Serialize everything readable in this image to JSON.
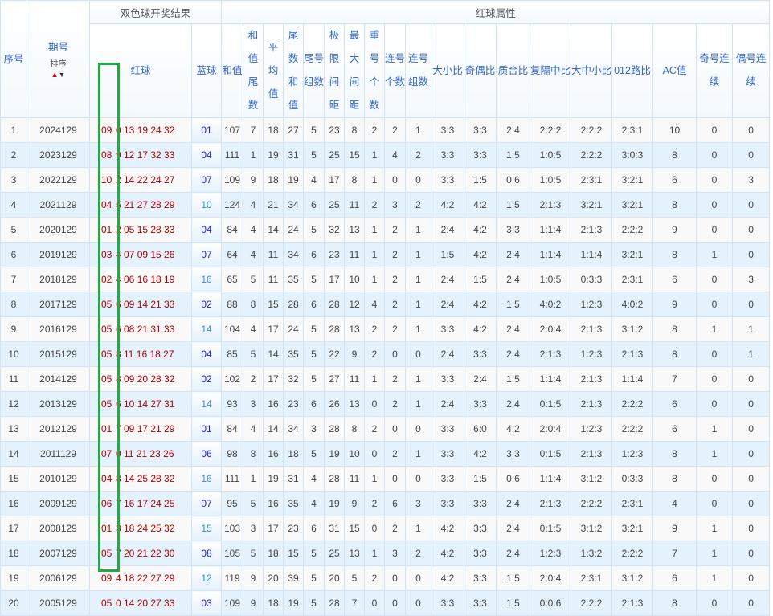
{
  "header": {
    "seq": "序号",
    "period": "期号",
    "sort_label": "排序",
    "sort_up": "▲",
    "sort_down": "▼",
    "result_group": "双色球开奖结果",
    "attr_group": "红球属性",
    "red": "红球",
    "blue": "蓝球",
    "columns": [
      "和值",
      "和值尾数",
      "平均值",
      "尾数和值",
      "尾号组数",
      "极限间距",
      "最大间距",
      "重号个数",
      "连号个数",
      "连号组数",
      "大小比",
      "奇偶比",
      "质合比",
      "复隔中比",
      "大中小比",
      "012路比",
      "AC值",
      "奇号连续",
      "偶号连续"
    ]
  },
  "colors": {
    "red_ball": "#b40000",
    "blue_ball_low": "#1a1ae6",
    "blue_ball_high": "#3d85f0",
    "highlight": "#22aa44",
    "row_alt": "#e3f2fd"
  },
  "rows": [
    [
      "1",
      "2024129",
      "09",
      "0 13 19 24 32",
      "01",
      "107",
      "7",
      "18",
      "27",
      "5",
      "23",
      "8",
      "2",
      "2",
      "1",
      "3:3",
      "3:3",
      "2:4",
      "2:2:2",
      "2:2:2",
      "2:3:1",
      "10",
      "0",
      "0"
    ],
    [
      "2",
      "2023129",
      "08",
      "9 12 17 32 33",
      "04",
      "111",
      "1",
      "19",
      "31",
      "5",
      "25",
      "15",
      "1",
      "4",
      "2",
      "3:3",
      "3:3",
      "1:5",
      "1:0:5",
      "2:2:2",
      "3:0:3",
      "8",
      "0",
      "0"
    ],
    [
      "3",
      "2022129",
      "10",
      "2 14 22 24 27",
      "07",
      "109",
      "9",
      "18",
      "19",
      "4",
      "17",
      "8",
      "1",
      "0",
      "0",
      "3:3",
      "1:5",
      "0:6",
      "1:0:5",
      "2:3:1",
      "3:2:1",
      "6",
      "0",
      "3"
    ],
    [
      "4",
      "2021129",
      "04",
      "5 21 27 28 29",
      "10",
      "124",
      "4",
      "21",
      "34",
      "6",
      "25",
      "11",
      "2",
      "3",
      "2",
      "4:2",
      "4:2",
      "1:5",
      "2:1:3",
      "3:2:1",
      "3:2:1",
      "8",
      "0",
      "0"
    ],
    [
      "5",
      "2020129",
      "01",
      "2 05 15 28 33",
      "04",
      "84",
      "4",
      "14",
      "24",
      "5",
      "32",
      "13",
      "1",
      "2",
      "1",
      "2:4",
      "4:2",
      "3:3",
      "1:1:4",
      "2:1:3",
      "2:2:2",
      "9",
      "0",
      "0"
    ],
    [
      "6",
      "2019129",
      "03",
      "4 07 09 15 26",
      "07",
      "64",
      "4",
      "11",
      "34",
      "6",
      "23",
      "11",
      "1",
      "2",
      "1",
      "1:5",
      "4:2",
      "2:4",
      "1:1:4",
      "1:1:4",
      "3:2:1",
      "8",
      "1",
      "0"
    ],
    [
      "7",
      "2018129",
      "02",
      "4 06 16 18 19",
      "16",
      "65",
      "5",
      "11",
      "35",
      "5",
      "17",
      "10",
      "1",
      "2",
      "1",
      "2:4",
      "1:5",
      "2:4",
      "1:0:5",
      "0:3:3",
      "2:3:1",
      "6",
      "0",
      "3"
    ],
    [
      "8",
      "2017129",
      "05",
      "6 09 14 21 33",
      "02",
      "88",
      "8",
      "15",
      "28",
      "6",
      "28",
      "12",
      "4",
      "2",
      "1",
      "2:4",
      "4:2",
      "1:5",
      "4:0:2",
      "1:2:3",
      "4:0:2",
      "9",
      "0",
      "0"
    ],
    [
      "9",
      "2016129",
      "05",
      "6 08 21 31 33",
      "14",
      "104",
      "4",
      "17",
      "24",
      "5",
      "28",
      "13",
      "2",
      "2",
      "1",
      "3:3",
      "4:2",
      "2:4",
      "2:0:4",
      "2:1:3",
      "3:1:2",
      "8",
      "1",
      "1"
    ],
    [
      "10",
      "2015129",
      "05",
      "8 11 16 18 27",
      "04",
      "85",
      "5",
      "14",
      "35",
      "5",
      "22",
      "9",
      "2",
      "0",
      "0",
      "2:4",
      "3:3",
      "2:4",
      "2:1:3",
      "1:2:3",
      "2:1:3",
      "8",
      "0",
      "1"
    ],
    [
      "11",
      "2014129",
      "05",
      "8 09 20 28 32",
      "02",
      "102",
      "2",
      "17",
      "32",
      "5",
      "27",
      "11",
      "1",
      "2",
      "1",
      "3:3",
      "2:4",
      "1:5",
      "1:1:4",
      "2:1:3",
      "1:1:4",
      "7",
      "0",
      "0"
    ],
    [
      "12",
      "2013129",
      "05",
      "6 10 14 27 31",
      "14",
      "93",
      "3",
      "16",
      "23",
      "6",
      "26",
      "13",
      "0",
      "2",
      "1",
      "2:4",
      "3:3",
      "2:4",
      "0:1:5",
      "2:1:3",
      "2:2:2",
      "6",
      "0",
      "0"
    ],
    [
      "13",
      "2012129",
      "01",
      "7 09 17 21 29",
      "01",
      "84",
      "4",
      "14",
      "34",
      "3",
      "28",
      "8",
      "2",
      "0",
      "0",
      "3:3",
      "6:0",
      "4:2",
      "2:0:4",
      "1:2:3",
      "2:2:2",
      "6",
      "1",
      "0"
    ],
    [
      "14",
      "2011129",
      "07",
      "0 11 21 23 26",
      "06",
      "98",
      "8",
      "16",
      "18",
      "5",
      "19",
      "10",
      "0",
      "2",
      "1",
      "3:3",
      "4:2",
      "3:3",
      "0:1:5",
      "2:1:3",
      "1:2:3",
      "8",
      "1",
      "0"
    ],
    [
      "15",
      "2010129",
      "04",
      "8 14 25 28 32",
      "16",
      "111",
      "1",
      "19",
      "31",
      "4",
      "28",
      "11",
      "1",
      "0",
      "0",
      "3:3",
      "1:5",
      "0:6",
      "1:1:4",
      "3:1:2",
      "0:3:3",
      "8",
      "0",
      "0"
    ],
    [
      "16",
      "2009129",
      "06",
      "7 16 17 24 25",
      "07",
      "95",
      "5",
      "16",
      "35",
      "4",
      "19",
      "9",
      "2",
      "6",
      "3",
      "3:3",
      "3:3",
      "2:4",
      "2:1:3",
      "2:2:2",
      "2:3:1",
      "4",
      "0",
      "0"
    ],
    [
      "17",
      "2008129",
      "01",
      "3 18 24 25 32",
      "15",
      "103",
      "3",
      "17",
      "23",
      "6",
      "31",
      "15",
      "0",
      "2",
      "1",
      "4:2",
      "3:3",
      "2:4",
      "0:1:5",
      "3:1:2",
      "3:2:1",
      "9",
      "1",
      "0"
    ],
    [
      "18",
      "2007129",
      "05",
      "7 20 21 22 30",
      "08",
      "105",
      "5",
      "18",
      "15",
      "5",
      "25",
      "13",
      "1",
      "3",
      "2",
      "4:2",
      "3:3",
      "2:4",
      "1:2:3",
      "1:3:2",
      "2:2:2",
      "7",
      "1",
      "0"
    ],
    [
      "19",
      "2006129",
      "09",
      "4 18 22 27 29",
      "12",
      "119",
      "9",
      "20",
      "39",
      "5",
      "20",
      "5",
      "2",
      "0",
      "0",
      "4:2",
      "3:3",
      "1:5",
      "2:0:4",
      "2:3:1",
      "3:1:2",
      "6",
      "1",
      "0"
    ],
    [
      "20",
      "2005129",
      "05",
      "0 14 20 27 33",
      "03",
      "109",
      "9",
      "18",
      "19",
      "5",
      "28",
      "7",
      "0",
      "0",
      "0",
      "3:3",
      "3:3",
      "1:5",
      "0:0:6",
      "2:2:2",
      "2:1:3",
      "8",
      "0",
      "0"
    ]
  ]
}
